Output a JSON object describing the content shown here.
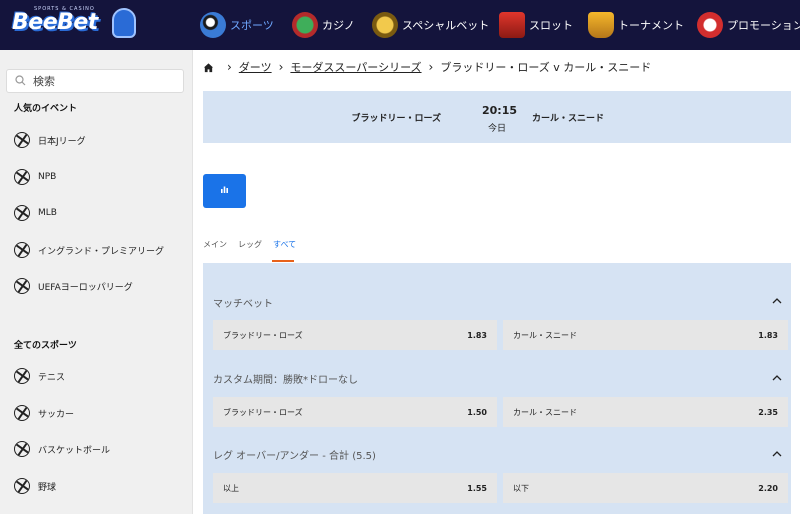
{
  "brand": {
    "name": "BeeBet",
    "tagline": "SPORTS & CASINO"
  },
  "nav": [
    {
      "label": "スポーツ",
      "icon": "sports-icon",
      "active": true
    },
    {
      "label": "カジノ",
      "icon": "casino-icon",
      "active": false
    },
    {
      "label": "スペシャルベット",
      "icon": "special-bet-icon",
      "active": false
    },
    {
      "label": "スロット",
      "icon": "slots-icon",
      "active": false
    },
    {
      "label": "トーナメント",
      "icon": "tournament-icon",
      "active": false
    },
    {
      "label": "プロモーション",
      "icon": "promotion-icon",
      "active": false
    }
  ],
  "sidebar": {
    "search_placeholder": "検索",
    "popular_heading": "人気のイベント",
    "popular": [
      {
        "label": "日本Jリーグ",
        "icon": "soccer-ball-icon"
      },
      {
        "label": "NPB",
        "icon": "baseball-icon"
      },
      {
        "label": "MLB",
        "icon": "baseball-icon"
      },
      {
        "label": "イングランド・プレミアリーグ",
        "icon": "soccer-ball-icon"
      },
      {
        "label": "UEFAヨーロッパリーグ",
        "icon": "soccer-ball-icon"
      }
    ],
    "all_heading": "全てのスポーツ",
    "all": [
      {
        "label": "テニス",
        "icon": "tennis-ball-icon"
      },
      {
        "label": "サッカー",
        "icon": "soccer-ball-icon"
      },
      {
        "label": "バスケットボール",
        "icon": "basketball-icon"
      },
      {
        "label": "野球",
        "icon": "baseball-icon"
      }
    ]
  },
  "breadcrumb": {
    "items": [
      "ダーツ",
      "モーダススーパーシリーズ",
      "ブラッドリー・ローズ v カール・スニード"
    ]
  },
  "match": {
    "home": "ブラッドリー・ローズ",
    "away": "カール・スニード",
    "time": "20:15",
    "day": "今日"
  },
  "tabs": [
    {
      "label": "メイン",
      "active": false
    },
    {
      "label": "レッグ",
      "active": false
    },
    {
      "label": "すべて",
      "active": true
    }
  ],
  "markets": [
    {
      "title": "マッチベット",
      "outcomes": [
        {
          "label": "ブラッドリー・ローズ",
          "price": "1.83"
        },
        {
          "label": "カール・スニード",
          "price": "1.83"
        }
      ]
    },
    {
      "title": "カスタム期間：勝敗*ドローなし",
      "outcomes": [
        {
          "label": "ブラッドリー・ローズ",
          "price": "1.50"
        },
        {
          "label": "カール・スニード",
          "price": "2.35"
        }
      ]
    },
    {
      "title": "レグ オーバー/アンダー - 合計 (5.5)",
      "outcomes": [
        {
          "label": "以上",
          "price": "1.55"
        },
        {
          "label": "以下",
          "price": "2.20"
        }
      ]
    }
  ],
  "colors": {
    "topbar": "#14143c",
    "accent": "#1a73e8",
    "tab_underline": "#e8621a",
    "panel": "#d6e3f3",
    "odds_cell": "#e6e6e6",
    "sidebar": "#f0f0f0"
  }
}
